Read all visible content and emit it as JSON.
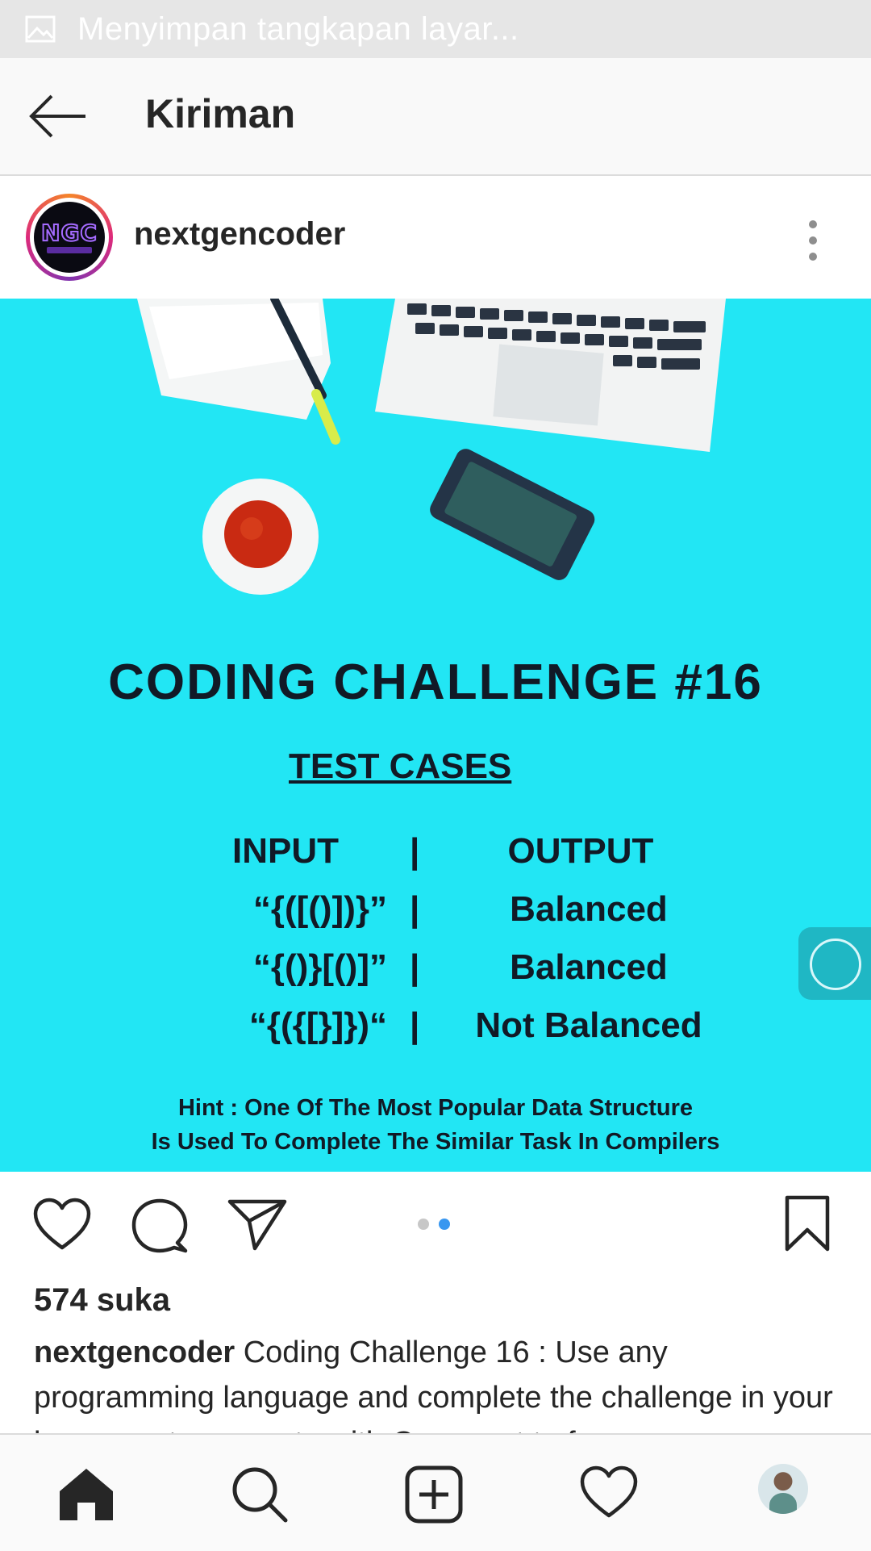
{
  "status_bar": {
    "notification_icon": "image-icon",
    "text": "Menyimpan tangkapan layar..."
  },
  "header": {
    "back_icon": "arrow-left-icon",
    "title": "Kiriman"
  },
  "post": {
    "username": "nextgencoder",
    "avatar_text": "NGC",
    "more_icon": "more-vertical-icon",
    "image": {
      "title": "CODING CHALLENGE  #16",
      "subtitle": "TEST CASES",
      "table": {
        "header": {
          "input": "INPUT",
          "sep": "|",
          "output": "OUTPUT"
        },
        "rows": [
          {
            "input": "“{([()])}”",
            "sep": "|",
            "output": "Balanced"
          },
          {
            "input": "“{()}[()]”",
            "sep": "|",
            "output": "Balanced"
          },
          {
            "input": "“{({[}]})“",
            "sep": "|",
            "output": "Not Balanced"
          }
        ]
      },
      "hint_line1": "Hint :  One Of The Most Popular Data Structure",
      "hint_line2": "Is Used To Complete The Similar Task In Compilers",
      "background_color": "#22e6f4"
    },
    "carousel": {
      "count": 2,
      "active_index": 1,
      "active_color": "#3897f0",
      "inactive_color": "#c7c7c7"
    },
    "likes": "574 suka",
    "caption_user": "nextgencoder",
    "caption_text": " Coding Challenge 16 : Use any programming language and complete the challenge in your  language  to  compete  with  Comment  to  f..."
  },
  "actions": {
    "like_icon": "heart-icon",
    "comment_icon": "comment-icon",
    "share_icon": "send-icon",
    "save_icon": "bookmark-icon"
  },
  "bottom_nav": {
    "items": [
      "home-icon",
      "search-icon",
      "add-post-icon",
      "activity-heart-icon",
      "profile-avatar"
    ]
  },
  "floating_button_icon": "assistive-touch-icon"
}
